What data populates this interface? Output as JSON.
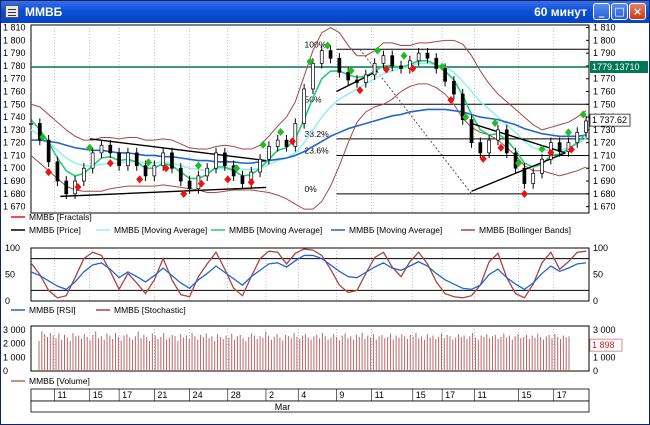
{
  "window": {
    "title": "ММВБ",
    "interval": "60 минут"
  },
  "colors": {
    "price_up": "#000000",
    "ma_light": "#99eeee",
    "ma_green": "#22cc77",
    "ma_blue": "#2266cc",
    "bollinger": "#aa4444",
    "fractal_up": "#22bb22",
    "fractal_down": "#ee1111",
    "level_line": "#007755",
    "rsi": "#2266cc",
    "stochastic": "#aa4444",
    "volume": "#bb6666"
  },
  "chart_data": [
    {
      "type": "line",
      "title": "",
      "yticks": [
        1810,
        1800,
        1790,
        1780,
        1770,
        1760,
        1750,
        1740,
        1730,
        1720,
        1710,
        1700,
        1690,
        1680,
        1670
      ],
      "ylim": [
        1665,
        1812
      ],
      "x": [
        0,
        3,
        6,
        9,
        12,
        15,
        18,
        21,
        24,
        27,
        30,
        33,
        36,
        39,
        42,
        45,
        48,
        51,
        54,
        57,
        60,
        63,
        66,
        69,
        72,
        75,
        78,
        81,
        84,
        87,
        90,
        93,
        96,
        99,
        102,
        105,
        108,
        111,
        114,
        117,
        120,
        123,
        126,
        129,
        132,
        135,
        138,
        141,
        144,
        147,
        150,
        153,
        156,
        159,
        162,
        165,
        168,
        171,
        174,
        177,
        180,
        183,
        186,
        189
      ],
      "series": [
        {
          "name": "ММВБ [Price]",
          "values": [
            1735,
            1722,
            1705,
            1690,
            1680,
            1690,
            1700,
            1712,
            1718,
            1712,
            1702,
            1712,
            1702,
            1694,
            1702,
            1712,
            1700,
            1690,
            1684,
            1694,
            1700,
            1712,
            1702,
            1694,
            1688,
            1697,
            1707,
            1717,
            1722,
            1717,
            1735,
            1762,
            1782,
            1792,
            1786,
            1775,
            1769,
            1767,
            1773,
            1782,
            1788,
            1780,
            1778,
            1784,
            1790,
            1786,
            1778,
            1768,
            1758,
            1738,
            1720,
            1712,
            1722,
            1730,
            1712,
            1700,
            1688,
            1696,
            1707,
            1720,
            1713,
            1720,
            1728,
            1737
          ]
        },
        {
          "name": "ММВБ [Moving Average]",
          "values": [
            1730,
            1726,
            1720,
            1714,
            1708,
            1704,
            1702,
            1702,
            1703,
            1704,
            1704,
            1705,
            1705,
            1704,
            1704,
            1705,
            1704,
            1702,
            1700,
            1699,
            1698,
            1699,
            1700,
            1700,
            1699,
            1699,
            1700,
            1703,
            1706,
            1708,
            1712,
            1720,
            1730,
            1740,
            1748,
            1754,
            1758,
            1762,
            1766,
            1770,
            1774,
            1776,
            1778,
            1780,
            1782,
            1782,
            1781,
            1779,
            1775,
            1768,
            1760,
            1752,
            1746,
            1740,
            1734,
            1728,
            1721,
            1716,
            1714,
            1714,
            1714,
            1716,
            1719,
            1723
          ]
        },
        {
          "name": "ММВБ [Moving Average]",
          "values": [
            1738,
            1730,
            1720,
            1708,
            1698,
            1694,
            1696,
            1702,
            1708,
            1709,
            1706,
            1707,
            1705,
            1700,
            1700,
            1704,
            1702,
            1697,
            1692,
            1692,
            1695,
            1701,
            1701,
            1698,
            1694,
            1695,
            1700,
            1707,
            1714,
            1716,
            1723,
            1738,
            1755,
            1770,
            1776,
            1776,
            1773,
            1771,
            1772,
            1776,
            1780,
            1780,
            1779,
            1781,
            1784,
            1784,
            1781,
            1776,
            1769,
            1757,
            1742,
            1730,
            1726,
            1727,
            1722,
            1714,
            1704,
            1701,
            1703,
            1710,
            1711,
            1715,
            1720,
            1727
          ]
        },
        {
          "name": "ММВБ [Moving Average]",
          "values": [
            1722,
            1722,
            1721,
            1720,
            1718,
            1716,
            1715,
            1714,
            1714,
            1713,
            1712,
            1712,
            1711,
            1710,
            1710,
            1709,
            1709,
            1708,
            1707,
            1706,
            1706,
            1705,
            1705,
            1705,
            1704,
            1704,
            1705,
            1706,
            1707,
            1708,
            1710,
            1713,
            1717,
            1721,
            1725,
            1728,
            1731,
            1733,
            1735,
            1737,
            1739,
            1741,
            1742,
            1744,
            1745,
            1746,
            1746,
            1746,
            1745,
            1744,
            1742,
            1740,
            1739,
            1738,
            1736,
            1734,
            1731,
            1729,
            1727,
            1726,
            1725,
            1725,
            1725,
            1726
          ]
        },
        {
          "name": "ММВБ [Bollinger Bands]",
          "values": [
            1750,
            1748,
            1742,
            1736,
            1730,
            1725,
            1722,
            1722,
            1724,
            1724,
            1723,
            1724,
            1724,
            1722,
            1722,
            1723,
            1722,
            1719,
            1716,
            1715,
            1715,
            1717,
            1718,
            1717,
            1715,
            1715,
            1718,
            1725,
            1733,
            1740,
            1752,
            1772,
            1792,
            1806,
            1810,
            1806,
            1796,
            1788,
            1788,
            1792,
            1798,
            1798,
            1796,
            1796,
            1798,
            1798,
            1799,
            1800,
            1800,
            1797,
            1788,
            1776,
            1766,
            1758,
            1752,
            1746,
            1740,
            1734,
            1730,
            1732,
            1734,
            1736,
            1740,
            1745
          ]
        },
        {
          "name": "ММВБ [Bollinger Bands]",
          "values": [
            1710,
            1704,
            1698,
            1692,
            1686,
            1683,
            1682,
            1682,
            1682,
            1684,
            1685,
            1686,
            1686,
            1686,
            1686,
            1687,
            1686,
            1685,
            1684,
            1683,
            1681,
            1681,
            1682,
            1683,
            1683,
            1683,
            1682,
            1681,
            1679,
            1676,
            1672,
            1668,
            1668,
            1674,
            1686,
            1702,
            1720,
            1736,
            1744,
            1748,
            1750,
            1754,
            1760,
            1764,
            1766,
            1766,
            1763,
            1758,
            1750,
            1739,
            1732,
            1728,
            1726,
            1722,
            1716,
            1710,
            1702,
            1698,
            1698,
            1696,
            1694,
            1696,
            1698,
            1701
          ]
        }
      ],
      "annotations": [
        {
          "label": "100%",
          "value": 1793
        },
        {
          "label": "50%",
          "value": 1750
        },
        {
          "label": "38.2%",
          "value": 1723
        },
        {
          "label": "23.6%",
          "value": 1710
        },
        {
          "label": "0%",
          "value": 1680
        }
      ],
      "horizontal_level": {
        "label": "1779.13710",
        "value": 1779.137
      },
      "last_price": {
        "label": "1 737.62",
        "value": 1737.62
      },
      "fractals_up_x": [
        4,
        20,
        40,
        57,
        70,
        79,
        85,
        95,
        101,
        109,
        118,
        127,
        140,
        148,
        158,
        166,
        174,
        183,
        188
      ],
      "fractals_down_x": [
        6,
        16,
        27,
        37,
        46,
        52,
        58,
        67,
        75,
        89,
        112,
        121,
        130,
        143,
        154,
        160,
        168,
        177,
        184
      ],
      "legend": [
        "ММВБ [Fractals]",
        "ММВБ [Price]",
        "ММВБ [Moving Average]",
        "ММВБ [Moving Average]",
        "ММВБ [Moving Average]",
        "ММВБ [Bollinger Bands]"
      ]
    },
    {
      "type": "line",
      "yticks": [
        100,
        50,
        0
      ],
      "ylim": [
        0,
        100
      ],
      "levels": [
        80,
        20
      ],
      "x": [
        0,
        3,
        6,
        9,
        12,
        15,
        18,
        21,
        24,
        27,
        30,
        33,
        36,
        39,
        42,
        45,
        48,
        51,
        54,
        57,
        60,
        63,
        66,
        69,
        72,
        75,
        78,
        81,
        84,
        87,
        90,
        93,
        96,
        99,
        102,
        105,
        108,
        111,
        114,
        117,
        120,
        123,
        126,
        129,
        132,
        135,
        138,
        141,
        144,
        147,
        150,
        153,
        156,
        159,
        162,
        165,
        168,
        171,
        174,
        177,
        180,
        183,
        186,
        189
      ],
      "series": [
        {
          "name": "ММВБ [RSI]",
          "values": [
            55,
            48,
            38,
            28,
            22,
            36,
            55,
            68,
            72,
            60,
            44,
            55,
            46,
            36,
            48,
            62,
            48,
            34,
            24,
            40,
            52,
            66,
            54,
            42,
            30,
            46,
            58,
            70,
            72,
            64,
            76,
            86,
            86,
            80,
            68,
            56,
            46,
            44,
            54,
            64,
            72,
            62,
            58,
            66,
            74,
            66,
            52,
            40,
            32,
            24,
            22,
            30,
            50,
            60,
            44,
            32,
            22,
            34,
            52,
            66,
            56,
            62,
            70,
            72
          ]
        },
        {
          "name": "ММВБ [Stochastic]",
          "values": [
            72,
            50,
            20,
            6,
            10,
            44,
            80,
            92,
            86,
            56,
            22,
            52,
            34,
            14,
            40,
            80,
            40,
            12,
            8,
            46,
            70,
            92,
            60,
            24,
            10,
            46,
            80,
            94,
            92,
            70,
            90,
            98,
            96,
            86,
            60,
            30,
            16,
            20,
            52,
            82,
            92,
            64,
            46,
            74,
            92,
            70,
            36,
            14,
            8,
            6,
            10,
            30,
            74,
            90,
            44,
            14,
            6,
            32,
            72,
            92,
            60,
            74,
            92,
            94
          ]
        }
      ],
      "legend": [
        "ММВБ [RSI]",
        "ММВБ [Stochastic]"
      ]
    },
    {
      "type": "bar",
      "yticks": [
        "3 000",
        "2 000",
        "1 000",
        "0"
      ],
      "ylim": [
        0,
        3300
      ],
      "values": [
        2200,
        2900,
        2700,
        2500,
        2800,
        2600,
        2400,
        2750,
        2300,
        2650,
        2450,
        2200,
        2800,
        2550,
        2600,
        2350,
        2700,
        2500,
        2250,
        2650,
        2900,
        2400,
        2550,
        2300,
        2750,
        2600,
        2350,
        2800,
        2500,
        2250,
        2600,
        2700,
        2450,
        2300,
        2550,
        2900,
        2400,
        2650,
        2500,
        2200,
        2750,
        2600,
        2350,
        2500,
        2800,
        2300,
        2450,
        2650,
        2550,
        2200,
        2700,
        2450,
        2600,
        2350,
        2800,
        2550,
        2300,
        2650,
        2500,
        2750,
        2400,
        2550,
        2200,
        2700,
        2500,
        2350,
        2600,
        2450,
        2750,
        2300,
        2550,
        2650,
        2400,
        2200,
        2500,
        2750,
        2600,
        2350,
        2550,
        2450,
        2900,
        2600,
        2300,
        2500,
        2700,
        2450,
        2250,
        2650,
        2550,
        2400,
        2800,
        2500,
        2350,
        2600,
        2700,
        2450,
        2300,
        2550,
        2650,
        2400,
        2800,
        2550,
        2300,
        2450,
        2700,
        2500,
        2250,
        2600,
        2750,
        2400,
        2550,
        2300,
        2650,
        2500,
        2800,
        2350,
        2600,
        2450,
        2700,
        2300,
        2550,
        2650,
        2400,
        2500,
        2750,
        2300,
        2600,
        2450,
        2700,
        2550,
        2350,
        2650,
        2500,
        2800,
        2400,
        2550,
        2300,
        2700,
        2450,
        2600,
        2350,
        2500,
        2750,
        2400,
        2650,
        2550,
        2300,
        2450,
        2700,
        2500,
        2600,
        2350,
        2550,
        2800,
        2450,
        2300,
        2600,
        2500,
        2700,
        2400,
        2550,
        2650,
        2350,
        2500,
        2750,
        2450,
        2600,
        2300,
        2550,
        2700,
        2400,
        2500,
        2650,
        2350,
        2600,
        2450,
        2750,
        2500,
        2300,
        2550,
        2650,
        2400,
        2700,
        2500,
        2350,
        2600,
        2450,
        2550
      ],
      "last_value": {
        "label": "1 898",
        "value": 1898
      },
      "legend": [
        "ММВБ [Volume]"
      ]
    }
  ],
  "x_axis": {
    "ticks": [
      {
        "label": "11",
        "x": 8
      },
      {
        "label": "15",
        "x": 20
      },
      {
        "label": "17",
        "x": 30
      },
      {
        "label": "21",
        "x": 42
      },
      {
        "label": "24",
        "x": 54
      },
      {
        "label": "28",
        "x": 67
      },
      {
        "label": "2",
        "x": 80
      },
      {
        "label": "4",
        "x": 91
      },
      {
        "label": "9",
        "x": 104
      },
      {
        "label": "11",
        "x": 116
      },
      {
        "label": "15",
        "x": 130
      },
      {
        "label": "17",
        "x": 140
      },
      {
        "label": "11",
        "x": 151
      },
      {
        "label": "15",
        "x": 166
      },
      {
        "label": "17",
        "x": 178
      }
    ],
    "month_label": "Mar",
    "month_x": 83
  }
}
